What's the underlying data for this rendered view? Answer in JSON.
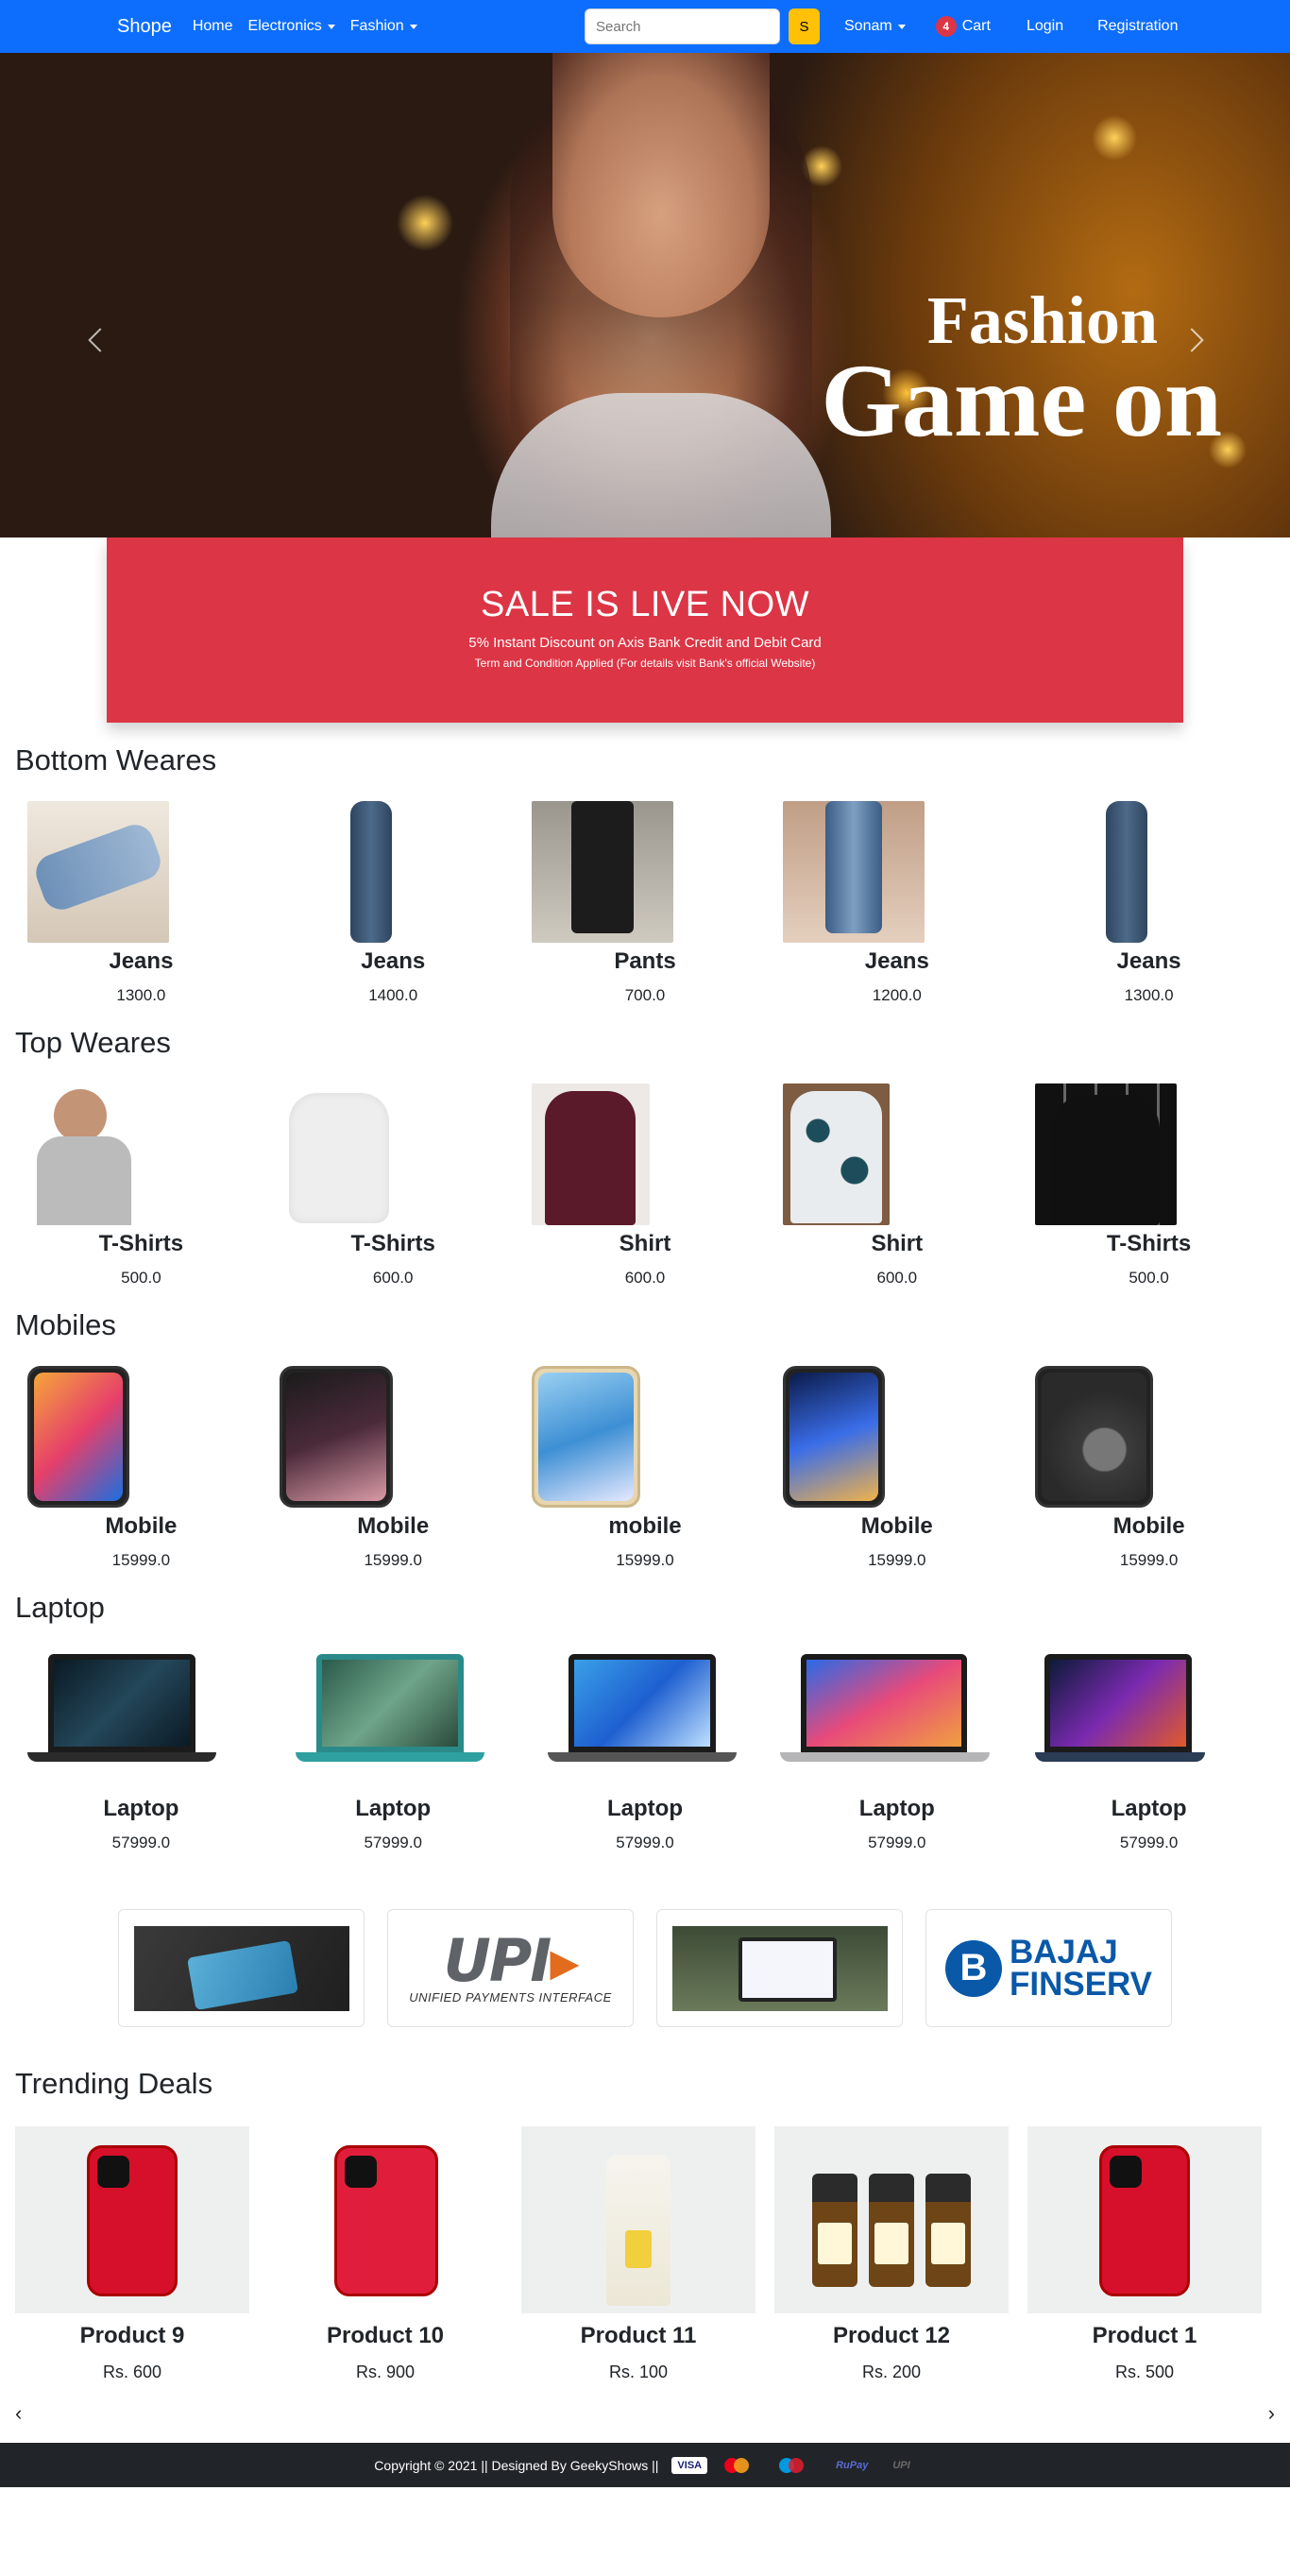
{
  "navbar": {
    "brand": "Shope",
    "links": [
      "Home",
      "Electronics",
      "Fashion"
    ],
    "search_placeholder": "Search",
    "search_button": "S",
    "user": "Sonam",
    "cart_count": "4",
    "cart_label": "Cart",
    "login": "Login",
    "registration": "Registration",
    "colors": {
      "bg": "#0d6efd",
      "search_btn": "#ffc107",
      "badge": "#dc3545"
    }
  },
  "hero": {
    "title_line1": "Fashion",
    "title_line2": "Game on"
  },
  "sale": {
    "title": "SALE IS LIVE NOW",
    "line1": "5% Instant Discount on Axis Bank Credit and Debit Card",
    "line2": "Term and Condition Applied (For details visit Bank's official Website)",
    "color": "#dc3545"
  },
  "sections": [
    {
      "title": "Bottom Weares",
      "items": [
        {
          "name": "Jeans",
          "price": "1300.0"
        },
        {
          "name": "Jeans",
          "price": "1400.0"
        },
        {
          "name": "Pants",
          "price": "700.0"
        },
        {
          "name": "Jeans",
          "price": "1200.0"
        },
        {
          "name": "Jeans",
          "price": "1300.0"
        }
      ]
    },
    {
      "title": "Top Weares",
      "items": [
        {
          "name": "T-Shirts",
          "price": "500.0"
        },
        {
          "name": "T-Shirts",
          "price": "600.0"
        },
        {
          "name": "Shirt",
          "price": "600.0"
        },
        {
          "name": "Shirt",
          "price": "600.0"
        },
        {
          "name": "T-Shirts",
          "price": "500.0"
        }
      ]
    },
    {
      "title": "Mobiles",
      "items": [
        {
          "name": "Mobile",
          "price": "15999.0"
        },
        {
          "name": "Mobile",
          "price": "15999.0"
        },
        {
          "name": "mobile",
          "price": "15999.0"
        },
        {
          "name": "Mobile",
          "price": "15999.0"
        },
        {
          "name": "Mobile",
          "price": "15999.0"
        }
      ]
    },
    {
      "title": "Laptop",
      "items": [
        {
          "name": "Laptop",
          "price": "57999.0"
        },
        {
          "name": "Laptop",
          "price": "57999.0"
        },
        {
          "name": "Laptop",
          "price": "57999.0"
        },
        {
          "name": "Laptop",
          "price": "57999.0"
        },
        {
          "name": "Laptop",
          "price": "57999.0"
        }
      ]
    }
  ],
  "payments": {
    "upi_logo": "UPI",
    "upi_sub": "UNIFIED PAYMENTS INTERFACE",
    "bajaj_b": "B",
    "bajaj_line1": "BAJAJ",
    "bajaj_line2": "FINSERV"
  },
  "trending": {
    "title": "Trending Deals",
    "items": [
      {
        "name": "Product 9",
        "price": "Rs. 600"
      },
      {
        "name": "Product 10",
        "price": "Rs. 900"
      },
      {
        "name": "Product 11",
        "price": "Rs. 100"
      },
      {
        "name": "Product 12",
        "price": "Rs. 200"
      },
      {
        "name": "Product 1",
        "price": "Rs. 500"
      }
    ],
    "prev": "‹",
    "next": "›"
  },
  "footer": {
    "text": "Copyright © 2021 || Designed By GeekyShows ||",
    "visa": "VISA",
    "rupay": "RuPay",
    "upi": "UPI"
  }
}
